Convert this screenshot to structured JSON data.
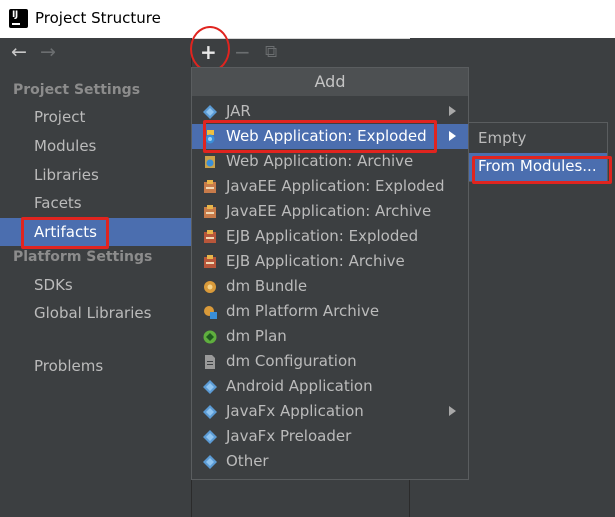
{
  "window": {
    "title": "Project Structure"
  },
  "nav": {
    "back": "←",
    "forward": "→"
  },
  "toolbar": {
    "add": "+",
    "remove": "−",
    "copy": "⧉"
  },
  "sidebar": {
    "project_settings_header": "Project Settings",
    "project_settings": [
      "Project",
      "Modules",
      "Libraries",
      "Facets",
      "Artifacts"
    ],
    "platform_settings_header": "Platform Settings",
    "platform_settings": [
      "SDKs",
      "Global Libraries"
    ],
    "problems": "Problems",
    "selected": "Artifacts"
  },
  "menu": {
    "header": "Add",
    "items": [
      {
        "label": "JAR",
        "icon": "diamond-icon",
        "submenu": true
      },
      {
        "label": "Web Application: Exploded",
        "icon": "web-app-icon",
        "submenu": true,
        "highlighted": true
      },
      {
        "label": "Web Application: Archive",
        "icon": "web-archive-icon"
      },
      {
        "label": "JavaEE Application: Exploded",
        "icon": "javaee-icon"
      },
      {
        "label": "JavaEE Application: Archive",
        "icon": "javaee-icon"
      },
      {
        "label": "EJB Application: Exploded",
        "icon": "ejb-icon"
      },
      {
        "label": "EJB Application: Archive",
        "icon": "ejb-icon"
      },
      {
        "label": "dm Bundle",
        "icon": "bundle-icon"
      },
      {
        "label": "dm Platform Archive",
        "icon": "bundle-archive-icon"
      },
      {
        "label": "dm Plan",
        "icon": "plan-icon"
      },
      {
        "label": "dm Configuration",
        "icon": "config-file-icon"
      },
      {
        "label": "Android Application",
        "icon": "diamond-icon"
      },
      {
        "label": "JavaFx Application",
        "icon": "diamond-icon",
        "submenu": true
      },
      {
        "label": "JavaFx Preloader",
        "icon": "diamond-icon"
      },
      {
        "label": "Other",
        "icon": "diamond-icon"
      }
    ]
  },
  "submenu": {
    "items": [
      {
        "label": "Empty"
      },
      {
        "label": "From Modules...",
        "highlighted": true
      }
    ]
  },
  "colors": {
    "background": "#3c3f41",
    "selection": "#4b6eaf",
    "annotation_red": "#e0241f",
    "menu_header": "#4d5052"
  }
}
